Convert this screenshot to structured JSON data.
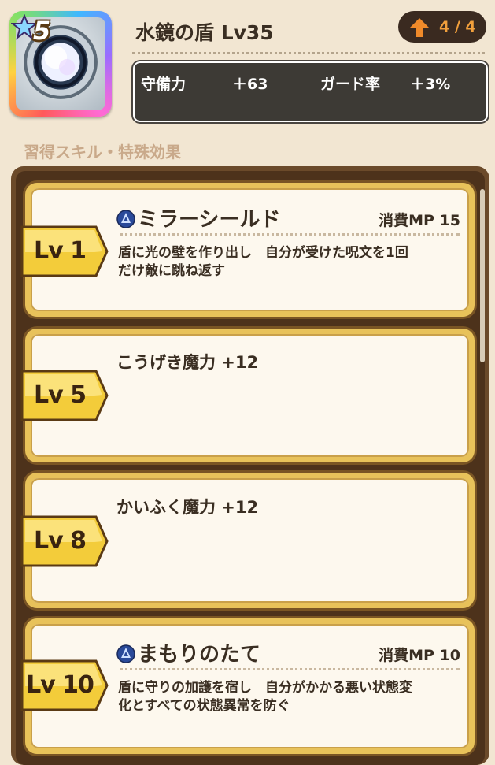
{
  "item": {
    "rarity": "5",
    "name": "水鏡の盾 Lv35",
    "upgrade": "4 / 4",
    "stats": [
      {
        "label": "守備力",
        "value": "＋63"
      },
      {
        "label": "ガード率",
        "value": "＋3%"
      }
    ]
  },
  "section_title": "習得スキル・特殊効果",
  "skills": [
    {
      "level": "Lv 1",
      "name": "ミラーシールド",
      "icon": "spell-icon",
      "mp": "消費MP 15",
      "desc1": "盾に光の壁を作り出し　自分が受けた呪文を1回",
      "desc2": "だけ敵に跳ね返す"
    },
    {
      "level": "Lv 5",
      "name": "こうげき魔力 +12"
    },
    {
      "level": "Lv 8",
      "name": "かいふく魔力 +12"
    },
    {
      "level": "Lv 10",
      "name": "まもりのたて",
      "icon": "spell-icon",
      "mp": "消費MP 10",
      "desc1": "盾に守りの加護を宿し　自分がかかる悪い状態変",
      "desc2": "化とすべての状態異常を防ぐ"
    }
  ],
  "colors": {
    "accent": "#f2a03c",
    "card_border": "#e8c25a",
    "panel": "#4d321b",
    "background": "#f2e6d2"
  }
}
